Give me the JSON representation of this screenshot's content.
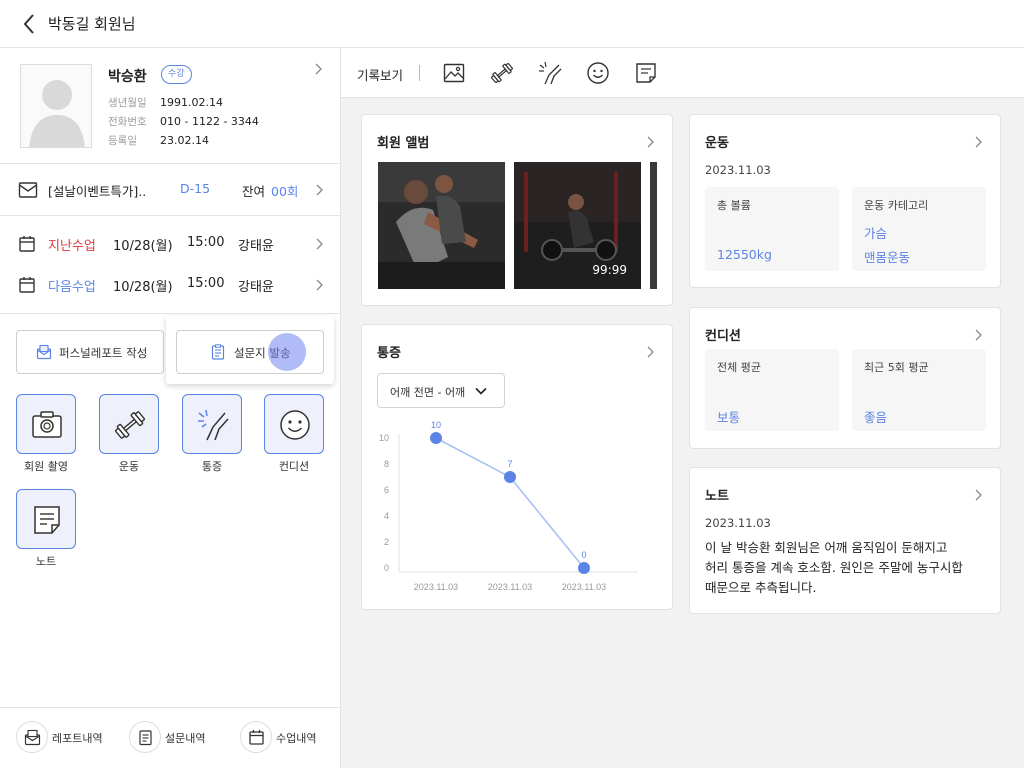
{
  "header": {
    "title": "박동길 회원님"
  },
  "profile": {
    "name": "박승환",
    "badge": "수강",
    "birth_label": "생년월일",
    "birth": "1991.02.14",
    "phone_label": "전화번호",
    "phone": "010 - 1122 - 3344",
    "reg_label": "등록일",
    "reg": "23.02.14"
  },
  "membership": {
    "name": "[설날이벤트특가]..",
    "dday": "D-15",
    "remain_label": "잔여",
    "remain_value": "00회"
  },
  "classes": [
    {
      "kind": "지난수업",
      "date": "10/28(월)",
      "time": "15:00",
      "trainer": "강태윤",
      "color": "#e03b3b"
    },
    {
      "kind": "다음수업",
      "date": "10/28(월)",
      "time": "15:00",
      "trainer": "강태윤",
      "color": "#5b84e6"
    }
  ],
  "actions": {
    "report": "퍼스널레포트 작성",
    "survey": "설문지 발송"
  },
  "tiles": [
    {
      "label": "회원 촬영",
      "icon": "camera-icon"
    },
    {
      "label": "운동",
      "icon": "dumbbell-icon"
    },
    {
      "label": "통증",
      "icon": "pain-icon"
    },
    {
      "label": "컨디션",
      "icon": "smile-icon"
    },
    {
      "label": "노트",
      "icon": "note-icon"
    }
  ],
  "history": {
    "report": "레포트내역",
    "survey": "설문내역",
    "class": "수업내역"
  },
  "toolbar": {
    "label": "기록보기",
    "icons": [
      "image-icon",
      "dumbbell-icon",
      "pain-icon",
      "smile-icon",
      "note-icon"
    ]
  },
  "album": {
    "title": "회원 앨범",
    "photo_label": "99:99"
  },
  "exercise": {
    "title": "운동",
    "date": "2023.11.03",
    "volume_label": "총 볼륨",
    "volume": "12550kg",
    "category_label": "운동 카테고리",
    "categories": [
      "가슴",
      "맨몸운동"
    ]
  },
  "pain": {
    "title": "통증",
    "selector": "어깨 전면 - 어깨"
  },
  "condition": {
    "title": "컨디션",
    "avg_label": "전체 평균",
    "avg": "보통",
    "recent_label": "최근 5회 평균",
    "recent": "좋음"
  },
  "note": {
    "title": "노트",
    "date": "2023.11.03",
    "line1": "이 날 박승환 회원님은 어깨 움직임이 둔해지고",
    "line2": "허리 통증을 계속 호소함. 원인은 주말에 농구시합",
    "line3": "때문으로 추측됩니다."
  },
  "colors": {
    "accent": "#5b84e6",
    "past": "#e03b3b",
    "line": "#a9c1f4"
  },
  "chart_data": {
    "type": "line",
    "categories": [
      "2023.11.03",
      "2023.11.03",
      "2023.11.03"
    ],
    "series": [
      {
        "values": [
          10,
          7,
          0
        ]
      }
    ],
    "yticks": [
      0,
      2,
      4,
      6,
      8,
      10
    ],
    "ylim": [
      0,
      10
    ],
    "data_labels": [
      "10",
      "7",
      "0"
    ]
  }
}
